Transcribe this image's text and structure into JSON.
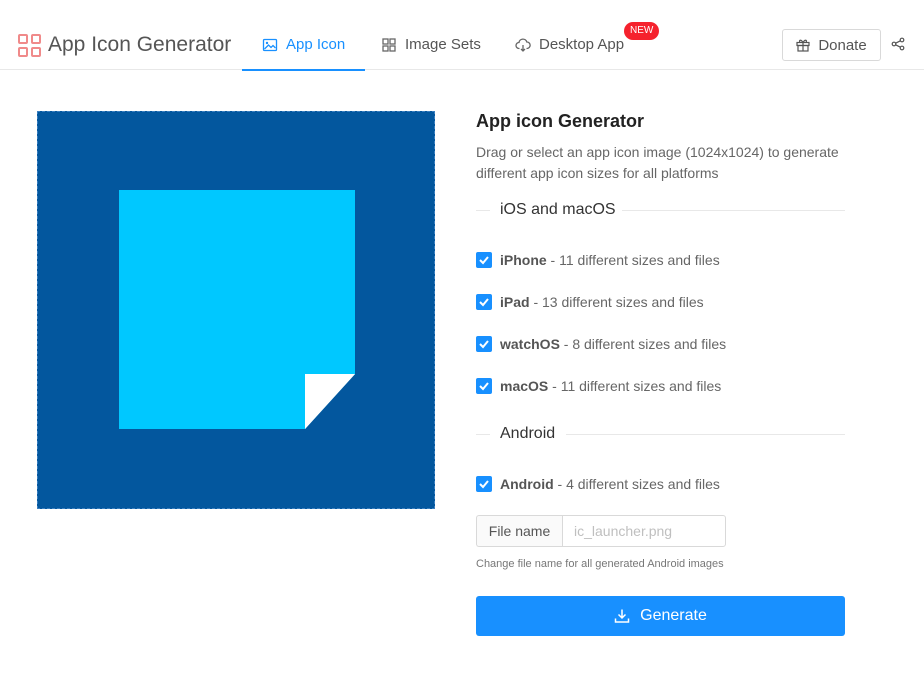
{
  "header": {
    "app_title": "App Icon Generator",
    "tabs": [
      {
        "label": "App Icon",
        "icon": "image-icon",
        "active": true
      },
      {
        "label": "Image Sets",
        "icon": "grid-icon",
        "active": false
      },
      {
        "label": "Desktop App",
        "icon": "cloud-download-icon",
        "active": false,
        "badge": "NEW"
      }
    ],
    "donate_label": "Donate",
    "accent_color": "#1890ff"
  },
  "preview": {
    "background_color": "#03579e",
    "note_color": "#00c8ff"
  },
  "panel": {
    "title": "App icon Generator",
    "description": "Drag or select an app icon image (1024x1024) to generate different app icon sizes for all platforms",
    "ios_section": {
      "label": "iOS and macOS",
      "options": [
        {
          "name": "iPhone",
          "detail": " - 11 different sizes and files",
          "checked": true
        },
        {
          "name": "iPad",
          "detail": " - 13 different sizes and files",
          "checked": true
        },
        {
          "name": "watchOS",
          "detail": " - 8 different sizes and files",
          "checked": true
        },
        {
          "name": "macOS",
          "detail": " - 11 different sizes and files",
          "checked": true
        }
      ]
    },
    "android_section": {
      "label": "Android",
      "options": [
        {
          "name": "Android",
          "detail": " - 4 different sizes and files",
          "checked": true
        }
      ]
    },
    "file_name": {
      "addon_label": "File name",
      "value": "",
      "placeholder": "ic_launcher.png",
      "hint": "Change file name for all generated Android images"
    },
    "generate_label": "Generate"
  }
}
